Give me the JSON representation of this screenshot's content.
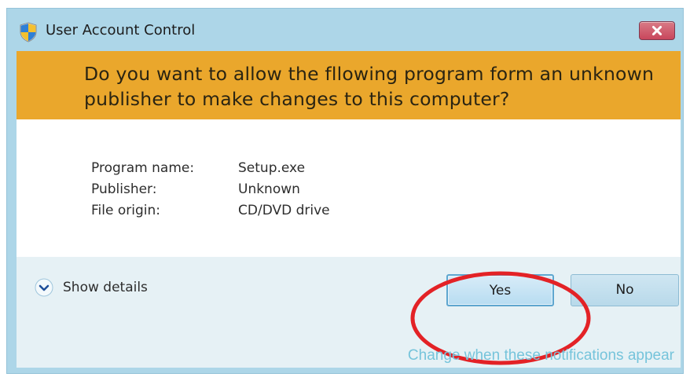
{
  "window": {
    "title": "User Account Control",
    "close_button": "close-icon"
  },
  "banner": {
    "question": "Do you want to allow the fllowing program form an unknown publisher to make changes to this computer?"
  },
  "program_info": [
    {
      "label": "Program name:",
      "value": "Setup.exe"
    },
    {
      "label": "Publisher:",
      "value": "Unknown"
    },
    {
      "label": "File origin:",
      "value": "CD/DVD drive"
    }
  ],
  "details": {
    "label": "Show details",
    "icon": "chevron-down-icon"
  },
  "buttons": {
    "yes": "Yes",
    "no": "No"
  },
  "link": {
    "text": "Change when these notifications appear"
  },
  "colors": {
    "banner": "#eaa72c",
    "frame": "#add6e8",
    "annotation_ring": "#e32226",
    "link": "#76c4db"
  }
}
